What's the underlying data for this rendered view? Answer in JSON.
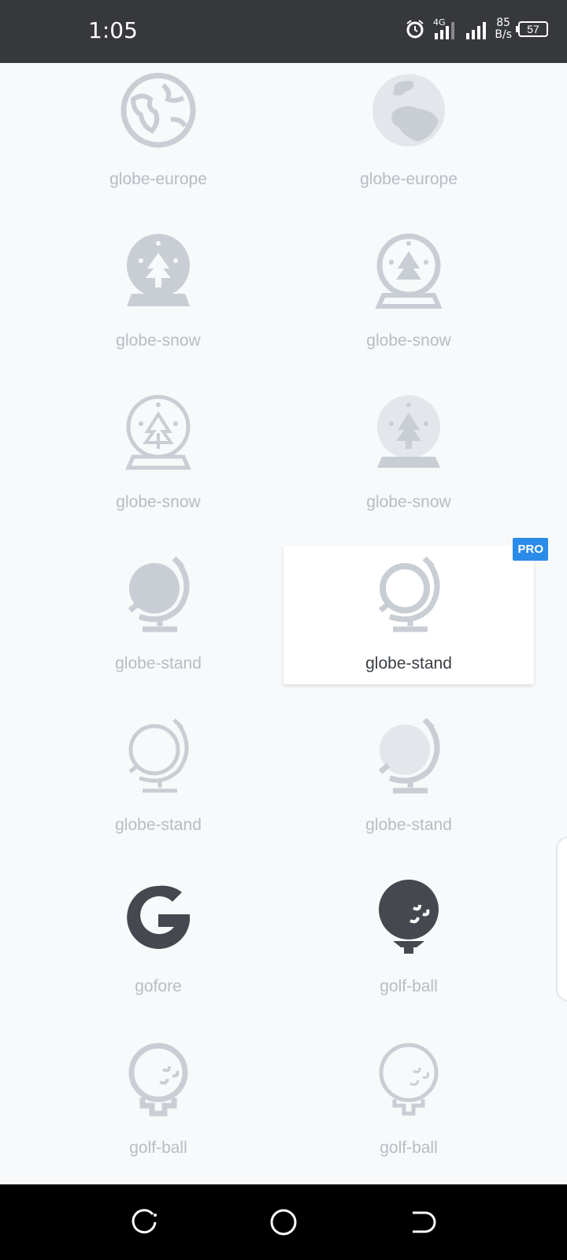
{
  "status": {
    "time": "1:05",
    "net_top": "85",
    "net_bottom": "B/s",
    "battery": "57"
  },
  "icons": [
    {
      "label": "globe-europe",
      "icon": "globe-europe-icon-outline",
      "style": "light"
    },
    {
      "label": "globe-europe",
      "icon": "globe-europe-icon-duotone",
      "style": "light"
    },
    {
      "label": "globe-snow",
      "icon": "globe-snow-icon-solid",
      "style": "light"
    },
    {
      "label": "globe-snow",
      "icon": "globe-snow-icon-regular",
      "style": "light"
    },
    {
      "label": "globe-snow",
      "icon": "globe-snow-icon-light",
      "style": "light"
    },
    {
      "label": "globe-snow",
      "icon": "globe-snow-icon-duotone",
      "style": "light"
    },
    {
      "label": "globe-stand",
      "icon": "globe-stand-icon-solid",
      "style": "light"
    },
    {
      "label": "globe-stand",
      "icon": "globe-stand-icon-regular",
      "style": "light",
      "selected": true,
      "badge": "PRO"
    },
    {
      "label": "globe-stand",
      "icon": "globe-stand-icon-light",
      "style": "light"
    },
    {
      "label": "globe-stand",
      "icon": "globe-stand-icon-duotone",
      "style": "light"
    },
    {
      "label": "gofore",
      "icon": "gofore-icon",
      "style": "dark"
    },
    {
      "label": "golf-ball",
      "icon": "golf-ball-icon-solid",
      "style": "dark"
    },
    {
      "label": "golf-ball",
      "icon": "golf-ball-icon-regular",
      "style": "light"
    },
    {
      "label": "golf-ball",
      "icon": "golf-ball-icon-light",
      "style": "light"
    }
  ],
  "colors": {
    "icon_light": "#c9ced5",
    "icon_dark": "#45494f",
    "accent": "#2a8be8"
  }
}
